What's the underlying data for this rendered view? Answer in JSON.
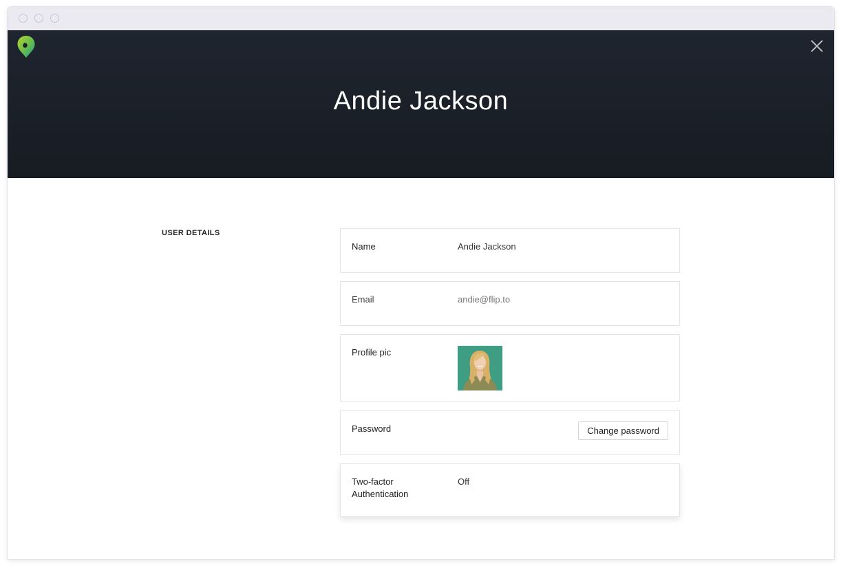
{
  "window": {
    "controls": [
      "close-dot",
      "minimize-dot",
      "zoom-dot"
    ]
  },
  "header": {
    "title": "Andie Jackson",
    "logo_icon": "map-pin-logo-icon",
    "close_icon": "close-icon"
  },
  "section": {
    "label": "USER DETAILS"
  },
  "fields": {
    "name": {
      "label": "Name",
      "value": "Andie Jackson"
    },
    "email": {
      "label": "Email",
      "value": "andie@flip.to"
    },
    "profile_pic": {
      "label": "Profile pic",
      "image": "profile-photo"
    },
    "password": {
      "label": "Password",
      "button_label": "Change password"
    },
    "two_factor": {
      "label_line1": "Two-factor",
      "label_line2": "Authentication",
      "value": "Off"
    }
  },
  "colors": {
    "header_bg": "#1b2028",
    "logo_green": "#8dc63f",
    "logo_teal": "#2aa58a",
    "avatar_bg": "#3f9d84"
  }
}
